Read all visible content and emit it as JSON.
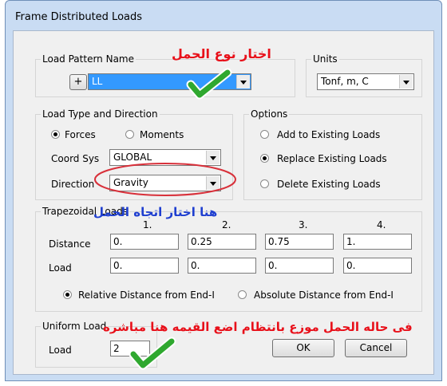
{
  "window": {
    "title": "Frame Distributed Loads"
  },
  "load_pattern": {
    "caption": "Load Pattern Name",
    "add_label": "+",
    "value": "LL"
  },
  "units": {
    "caption": "Units",
    "value": "Tonf, m, C"
  },
  "load_type": {
    "caption": "Load Type and Direction",
    "forces_label": "Forces",
    "moments_label": "Moments",
    "selected": "Forces",
    "coord_label": "Coord Sys",
    "coord_value": "GLOBAL",
    "direction_label": "Direction",
    "direction_value": "Gravity"
  },
  "options": {
    "caption": "Options",
    "items": [
      {
        "label": "Add to Existing Loads",
        "checked": false
      },
      {
        "label": "Replace Existing Loads",
        "checked": true
      },
      {
        "label": "Delete Existing Loads",
        "checked": false
      }
    ]
  },
  "trapezoidal": {
    "caption": "Trapezoidal Loads",
    "columns": [
      "1.",
      "2.",
      "3.",
      "4."
    ],
    "distance_label": "Distance",
    "distance": [
      "0.",
      "0.25",
      "0.75",
      "1."
    ],
    "load_label": "Load",
    "load": [
      "0.",
      "0.",
      "0.",
      "0."
    ],
    "relative_label": "Relative Distance from End-I",
    "absolute_label": "Absolute Distance from End-I",
    "selected": "relative"
  },
  "uniform": {
    "caption": "Uniform Load",
    "load_label": "Load",
    "value": "2"
  },
  "buttons": {
    "ok": "OK",
    "cancel": "Cancel"
  },
  "annotations": {
    "pattern_note": "اختار نوع الحمل",
    "direction_note": "هنا اختار اتجاه الحمل",
    "uniform_note": "فى حاله الحمل موزع بانتظام اضع القيمه هنا مباشره"
  },
  "colors": {
    "annotation_red": "#e8101a",
    "annotation_blue": "#1f3fd0",
    "checkmark_green": "#2fa82f",
    "highlight_ring": "#d8303a"
  }
}
